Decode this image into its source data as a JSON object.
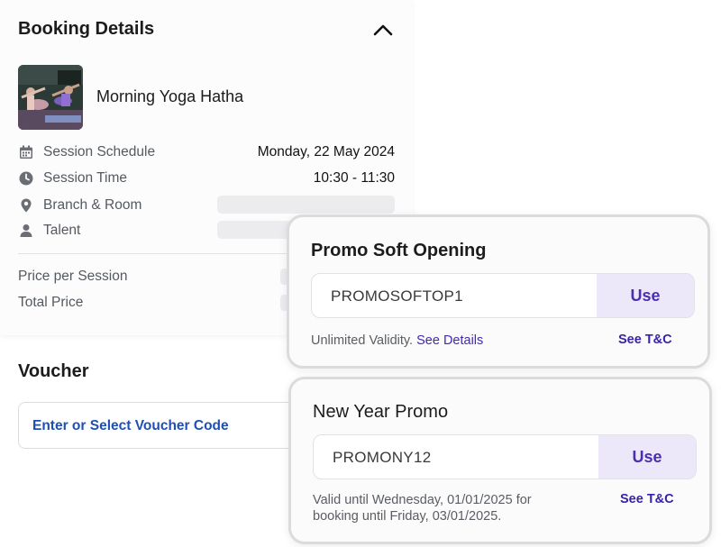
{
  "booking": {
    "title": "Booking Details",
    "class_name": "Morning Yoga Hatha",
    "details": [
      {
        "icon": "calendar-icon",
        "label": "Session Schedule",
        "value": "Monday, 22 May 2024"
      },
      {
        "icon": "clock-icon",
        "label": "Session Time",
        "value": "10:30 - 11:30"
      },
      {
        "icon": "location-pin-icon",
        "label": "Branch & Room",
        "value": null
      },
      {
        "icon": "person-icon",
        "label": "Talent",
        "value": null
      }
    ],
    "price_per_session_label": "Price per Session",
    "total_price_label": "Total Price"
  },
  "voucher": {
    "title": "Voucher",
    "input_text": "Enter or Select Voucher Code"
  },
  "promos": [
    {
      "title": "Promo Soft Opening",
      "code": "PROMOSOFTOP1",
      "use_label": "Use",
      "note": "Unlimited Validity.",
      "details_link": "See Details",
      "tc_label": "See T&C"
    },
    {
      "title": "New Year Promo",
      "code": "PROMONY12",
      "use_label": "Use",
      "note_line1": "Valid until Wednesday, 01/01/2025 for",
      "note_line2": "booking until Friday, 03/01/2025.",
      "tc_label": "See T&C"
    }
  ],
  "colors": {
    "accent": "#4a2fb0",
    "use_button_bg": "#ece8fa",
    "voucher_link": "#1f4fb5"
  }
}
